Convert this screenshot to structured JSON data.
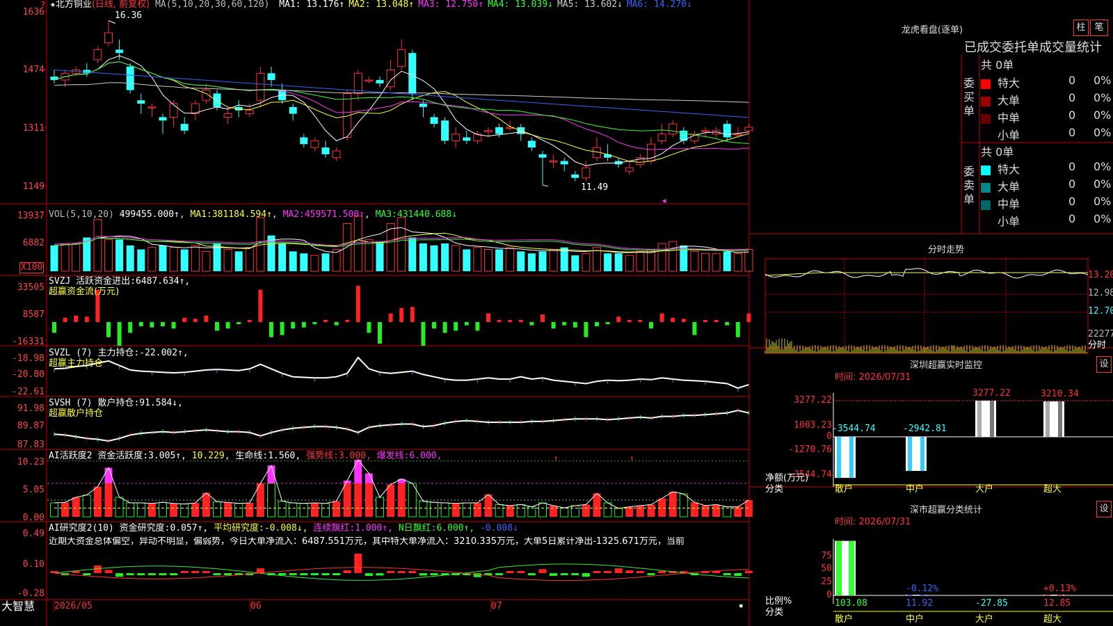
{
  "header": {
    "star": "★",
    "stock_name": "北方铜业",
    "period": "(日线, 前复权)",
    "ma_spec": "MA(5,10,20,30,60,120)",
    "ma": [
      {
        "label": "MA1:",
        "value": "13.176↑",
        "color": "#ffffff"
      },
      {
        "label": "MA2:",
        "value": "13.048↑",
        "color": "#ffff33"
      },
      {
        "label": "MA3:",
        "value": "12.750↑",
        "color": "#ff33ff"
      },
      {
        "label": "MA4:",
        "value": "13.039↓",
        "color": "#33ff33"
      },
      {
        "label": "MA5:",
        "value": "13.602↓",
        "color": "#cccccc"
      },
      {
        "label": "MA6:",
        "value": "14.270↓",
        "color": "#3366ff"
      }
    ]
  },
  "price_axis": [
    "1636",
    "1474",
    "1311",
    "1149"
  ],
  "price_marks": {
    "high": "16.36",
    "low": "11.49"
  },
  "vol": {
    "spec": "VOL(5,10,20)",
    "value": "499455.000↑",
    "ma1_label": "MA1:",
    "ma1": "381184.594↑",
    "ma2_label": "MA2:",
    "ma2": "459571.500↑",
    "ma3_label": "MA3:",
    "ma3": "431440.688↓",
    "axis": [
      "13937",
      "6882"
    ],
    "unit": "X100"
  },
  "svzj": {
    "title": "SVZJ  活跃资金进出:",
    "value": "6487.634↑,",
    "subtitle": "超赢资金流(万元)",
    "axis": [
      "33505",
      "8587",
      "-16331"
    ]
  },
  "svzl": {
    "title": "SVZL (7) 主力持仓:",
    "value": "-22.002↑,",
    "subtitle": "超赢主力持仓",
    "axis": [
      "-18.98",
      "-20.80",
      "-22.61"
    ]
  },
  "svsh": {
    "title": "SVSH (7) 散户持仓:",
    "value": "91.584↓,",
    "subtitle": "超赢散户持仓",
    "axis": [
      "91.98",
      "89.87",
      "87.83"
    ]
  },
  "ai_act": {
    "title": "AI活跃度2 资金活跃度:",
    "value": "3.005↑,",
    "v2": "10.229,",
    "life_label": "生命线:",
    "life": "1.560,",
    "strong_label": "强势线:",
    "strong": "3.000,",
    "burst_label": "爆发线:",
    "burst": "6.000,",
    "axis": [
      "10.23",
      "5.05",
      "0.00"
    ]
  },
  "ai_res": {
    "title": "AI研究度2(10) 资金研究度:",
    "value": "0.057↑,",
    "avg_label": "平均研究度:",
    "avg": "-0.008↓,",
    "cont_label": "连续飘红:",
    "cont": "1.000↑,",
    "nday_label": "N日飘红:",
    "nday": "6.000↑,",
    "last": "-0.008↓",
    "comment": "近期大资金总体偏空，异动不明显，偏弱势，今日大单净流入：6487.551万元，其中特大单净流入：3210.335万元，大单5日累计净出-1325.671万元，当前",
    "axis": [
      "0.49",
      "0.10",
      "-0.28"
    ]
  },
  "date_axis": {
    "brand": "大智慧",
    "d1": "2026/05",
    "d2": "06",
    "d3": "07"
  },
  "longhu": {
    "title": "龙虎看盘(逐单)",
    "btn1": "柱",
    "btn2": "笔",
    "heading": "已成交委托单成交量统计",
    "buy_total": "共 0单",
    "buy_side": "委买单",
    "sell_total": "共 0单",
    "sell_side": "委卖单",
    "buy_rows": [
      {
        "name": "特大",
        "count": "0",
        "pct": "0%",
        "color": "#ff0000"
      },
      {
        "name": "大单",
        "count": "0",
        "pct": "0%",
        "color": "#990000"
      },
      {
        "name": "中单",
        "count": "0",
        "pct": "0%",
        "color": "#660000"
      },
      {
        "name": "小单",
        "count": "0",
        "pct": "0%",
        "color": ""
      }
    ],
    "sell_rows": [
      {
        "name": "特大",
        "count": "0",
        "pct": "0%",
        "color": "#00ffff"
      },
      {
        "name": "大单",
        "count": "0",
        "pct": "0%",
        "color": "#008888"
      },
      {
        "name": "中单",
        "count": "0",
        "pct": "0%",
        "color": "#006666"
      },
      {
        "name": "小单",
        "count": "0",
        "pct": "0%",
        "color": ""
      }
    ]
  },
  "intraday": {
    "title": "分时走势",
    "axis": [
      "13.20",
      "12.98",
      "12.70"
    ],
    "vol_label": "22277",
    "unit": "分时"
  },
  "monitor": {
    "title": "深圳超赢实时监控",
    "btn": "设",
    "time": "时间: 2026/07/31",
    "axis": [
      "3277.22",
      "1003.23",
      "0",
      "-1270.76",
      "-3544.74"
    ],
    "ylabel": "净额(万元)",
    "xlabel": "分类",
    "bars": [
      {
        "cat": "散户",
        "value": "-3544.74"
      },
      {
        "cat": "中户",
        "value": "-2942.81"
      },
      {
        "cat": "大户",
        "value": "3277.22"
      },
      {
        "cat": "超大",
        "value": "3210.34"
      }
    ]
  },
  "classify": {
    "title": "深市超赢分类统计",
    "btn": "设",
    "time": "时间: 2026/07/31",
    "axis": [
      "75",
      "50",
      "25",
      "0"
    ],
    "ylabel": "比例%",
    "xlabel": "分类",
    "bars": [
      {
        "cat": "散户",
        "value": "103.08",
        "label": ""
      },
      {
        "cat": "中户",
        "value": "11.92",
        "label": "-0.12%"
      },
      {
        "cat": "大户",
        "value": "-27.85",
        "label": ""
      },
      {
        "cat": "超大",
        "value": "12.85",
        "label": "+0.13%"
      }
    ]
  },
  "chart_data": {
    "type": "candlestick",
    "colors": {
      "up": "#ff3333",
      "down": "#33ffff",
      "ma1": "#ffffff",
      "ma2": "#ffff33",
      "ma3": "#ff33ff",
      "ma4": "#33ff33",
      "ma5": "#cccccc",
      "ma6": "#3366ff"
    },
    "price_range": [
      11.2,
      16.6
    ],
    "candles": [
      [
        14.7,
        14.6,
        14.9,
        14.5
      ],
      [
        14.6,
        14.8,
        14.9,
        14.4
      ],
      [
        14.8,
        14.9,
        15.0,
        14.7
      ],
      [
        14.9,
        14.8,
        15.1,
        14.7
      ],
      [
        15.2,
        15.5,
        15.6,
        15.1
      ],
      [
        15.7,
        16.0,
        16.36,
        15.6
      ],
      [
        15.5,
        15.4,
        15.8,
        15.2
      ],
      [
        15.0,
        14.3,
        15.1,
        14.2
      ],
      [
        14.0,
        13.9,
        14.2,
        13.6
      ],
      [
        13.8,
        13.8,
        13.9,
        13.5
      ],
      [
        13.5,
        13.4,
        13.6,
        13.0
      ],
      [
        13.5,
        13.9,
        14.0,
        13.2
      ],
      [
        13.3,
        13.1,
        13.5,
        13.0
      ],
      [
        13.6,
        13.9,
        14.0,
        13.4
      ],
      [
        14.0,
        14.3,
        14.5,
        13.9
      ],
      [
        14.2,
        13.8,
        14.3,
        13.7
      ],
      [
        13.5,
        13.6,
        13.8,
        13.3
      ],
      [
        13.8,
        13.7,
        14.0,
        13.5
      ],
      [
        13.6,
        13.7,
        13.9,
        13.5
      ],
      [
        14.0,
        14.8,
        15.0,
        13.8
      ],
      [
        14.8,
        14.6,
        15.0,
        14.4
      ],
      [
        14.3,
        14.0,
        14.5,
        13.9
      ],
      [
        13.8,
        13.6,
        13.9,
        13.4
      ],
      [
        12.9,
        12.7,
        13.0,
        12.6
      ],
      [
        12.6,
        12.8,
        12.9,
        12.5
      ],
      [
        12.6,
        12.4,
        12.8,
        12.3
      ],
      [
        12.3,
        12.5,
        12.6,
        12.2
      ],
      [
        12.9,
        14.2,
        14.3,
        12.8
      ],
      [
        14.2,
        14.8,
        14.9,
        14.0
      ],
      [
        14.6,
        14.6,
        14.7,
        14.5
      ],
      [
        14.6,
        14.5,
        14.7,
        14.4
      ],
      [
        14.4,
        14.9,
        15.2,
        14.3
      ],
      [
        15.0,
        15.5,
        15.8,
        14.9
      ],
      [
        15.4,
        14.2,
        15.5,
        14.0
      ],
      [
        13.9,
        13.8,
        14.0,
        13.5
      ],
      [
        13.5,
        13.3,
        13.6,
        13.2
      ],
      [
        13.4,
        12.8,
        13.5,
        12.7
      ],
      [
        12.8,
        13.0,
        13.2,
        12.6
      ],
      [
        12.9,
        12.8,
        13.1,
        12.7
      ],
      [
        12.8,
        13.0,
        13.1,
        12.7
      ],
      [
        13.1,
        13.1,
        13.2,
        12.9
      ],
      [
        13.2,
        13.0,
        13.3,
        12.9
      ],
      [
        13.2,
        13.2,
        13.4,
        13.1
      ],
      [
        13.2,
        13.0,
        13.3,
        12.8
      ],
      [
        12.8,
        12.6,
        12.9,
        12.5
      ],
      [
        12.4,
        12.3,
        12.5,
        11.49
      ],
      [
        12.2,
        12.2,
        12.4,
        12.0
      ],
      [
        12.2,
        12.1,
        12.3,
        11.9
      ],
      [
        11.8,
        11.7,
        11.9,
        11.6
      ],
      [
        11.7,
        12.0,
        12.2,
        11.6
      ],
      [
        12.3,
        12.6,
        12.9,
        12.2
      ],
      [
        12.4,
        12.3,
        12.7,
        12.2
      ],
      [
        12.2,
        12.1,
        12.3,
        12.0
      ],
      [
        11.9,
        12.0,
        12.2,
        11.8
      ],
      [
        12.1,
        12.3,
        12.4,
        12.0
      ],
      [
        12.2,
        12.7,
        12.9,
        12.1
      ],
      [
        12.8,
        13.0,
        13.3,
        12.7
      ],
      [
        13.0,
        13.3,
        13.4,
        12.9
      ],
      [
        13.1,
        12.8,
        13.2,
        12.7
      ],
      [
        12.8,
        13.0,
        13.1,
        12.7
      ],
      [
        13.1,
        13.1,
        13.2,
        12.9
      ],
      [
        13.0,
        13.1,
        13.2,
        12.9
      ],
      [
        13.3,
        12.9,
        13.4,
        12.8
      ],
      [
        13.0,
        13.0,
        13.2,
        12.9
      ],
      [
        13.1,
        13.2,
        13.3,
        13.0
      ]
    ],
    "volume": [
      6.5,
      6.8,
      7.0,
      8.5,
      13.0,
      8.0,
      8.0,
      6.5,
      5.5,
      6.0,
      6.5,
      6.0,
      5.5,
      6.5,
      5.0,
      7.0,
      5.5,
      5.0,
      6.0,
      13.5,
      9.0,
      7.0,
      5.0,
      4.5,
      4.0,
      4.5,
      5.5,
      12.0,
      13.937,
      8.0,
      7.5,
      12.0,
      13.5,
      8.5,
      7.0,
      6.5,
      7.0,
      6.5,
      5.5,
      6.0,
      5.5,
      5.5,
      6.0,
      5.0,
      4.5,
      5.0,
      5.5,
      6.0,
      4.0,
      4.5,
      6.0,
      4.5,
      4.5,
      4.0,
      5.0,
      5.5,
      7.0,
      7.5,
      6.5,
      5.0,
      4.5,
      4.5,
      5.0,
      4.5,
      5.5
    ],
    "svzj": [
      -10,
      4,
      6,
      5,
      30,
      -14,
      -22,
      -10,
      -4,
      -5,
      -4,
      -6,
      4,
      3,
      6,
      -8,
      -6,
      -2,
      1,
      30,
      -14,
      -12,
      -6,
      -5,
      -2,
      2,
      -3,
      2,
      33.5,
      -10,
      -20,
      8,
      13,
      14,
      -22,
      -6,
      -10,
      -8,
      -3,
      -8,
      8,
      2,
      1,
      0,
      -3,
      7,
      -6,
      -3,
      -5,
      -14,
      -4,
      -2,
      5,
      2,
      1,
      -6,
      8,
      4,
      3,
      -12,
      1,
      2,
      -3,
      -14,
      8
    ],
    "svzl": [
      -20.6,
      -20.55,
      -20.4,
      -20.3,
      -20.1,
      -19.9,
      -20.3,
      -20.7,
      -20.8,
      -20.85,
      -20.9,
      -20.95,
      -20.9,
      -20.8,
      -20.7,
      -20.65,
      -20.7,
      -20.75,
      -20.6,
      -20.2,
      -20.6,
      -21.0,
      -21.3,
      -21.35,
      -21.4,
      -21.4,
      -21.3,
      -21.0,
      -19.6,
      -20.6,
      -20.9,
      -21.0,
      -20.9,
      -20.8,
      -21.1,
      -21.3,
      -21.5,
      -21.6,
      -21.6,
      -21.5,
      -21.4,
      -21.5,
      -21.5,
      -21.3,
      -21.5,
      -21.4,
      -21.6,
      -21.7,
      -21.8,
      -21.9,
      -21.7,
      -21.6,
      -21.65,
      -21.6,
      -21.5,
      -21.55,
      -21.4,
      -21.5,
      -21.6,
      -21.65,
      -21.7,
      -21.8,
      -21.9,
      -22.3,
      -22.0
    ],
    "svsh": [
      89.1,
      89.0,
      88.8,
      88.6,
      88.5,
      88.3,
      88.6,
      89.0,
      89.2,
      89.3,
      89.4,
      89.3,
      89.4,
      89.5,
      89.6,
      89.5,
      89.4,
      89.4,
      89.3,
      88.9,
      89.3,
      89.6,
      89.8,
      89.9,
      90.0,
      90.0,
      89.9,
      89.7,
      89.3,
      89.9,
      90.1,
      90.2,
      90.3,
      90.3,
      90.0,
      90.1,
      90.4,
      90.6,
      90.7,
      90.6,
      90.5,
      90.5,
      90.5,
      90.5,
      90.6,
      90.6,
      90.7,
      90.8,
      90.9,
      90.9,
      90.9,
      90.8,
      90.9,
      91.0,
      91.1,
      91.0,
      91.2,
      91.2,
      91.3,
      91.3,
      91.4,
      91.5,
      91.6,
      91.9,
      91.6
    ],
    "ai_act": [
      2.5,
      2.6,
      3.5,
      3.9,
      5.4,
      8.8,
      3.5,
      2.5,
      2.5,
      2.4,
      2.6,
      2.4,
      2.3,
      2.5,
      4.3,
      2.7,
      2.6,
      2.4,
      2.5,
      6.0,
      9.2,
      2.8,
      2.5,
      2.4,
      2.5,
      2.4,
      2.8,
      6.5,
      10.23,
      7.8,
      3.5,
      5.8,
      6.8,
      6.0,
      2.8,
      2.6,
      2.5,
      2.4,
      2.5,
      2.5,
      4.0,
      2.2,
      2.0,
      2.2,
      1.8,
      2.5,
      2.0,
      1.6,
      2.0,
      2.2,
      4.2,
      2.5,
      1.5,
      1.8,
      2.0,
      2.2,
      3.3,
      4.5,
      4.1,
      2.6,
      2.0,
      2.2,
      1.8,
      1.8,
      3.0
    ],
    "ai_res": [
      0.02,
      -0.03,
      0.05,
      -0.02,
      0.19,
      0.08,
      -0.09,
      -0.04,
      -0.05,
      -0.03,
      -0.02,
      -0.05,
      0.03,
      0.05,
      0.02,
      -0.05,
      -0.04,
      -0.02,
      -0.04,
      0.12,
      -0.04,
      -0.04,
      -0.05,
      -0.03,
      -0.02,
      -0.02,
      -0.02,
      0.07,
      0.49,
      -0.07,
      -0.06,
      0.02,
      0.03,
      0.02,
      -0.06,
      -0.04,
      -0.05,
      -0.04,
      -0.05,
      -0.1,
      -0.05,
      -0.04,
      0.03,
      0.04,
      -0.05,
      0.1,
      -0.07,
      -0.05,
      -0.02,
      -0.09,
      0.02,
      0.05,
      0.12,
      0.07,
      0.05,
      -0.05,
      0.05,
      0.03,
      0.02,
      -0.03,
      0.03,
      0.02,
      -0.04,
      -0.07,
      0.06
    ]
  }
}
